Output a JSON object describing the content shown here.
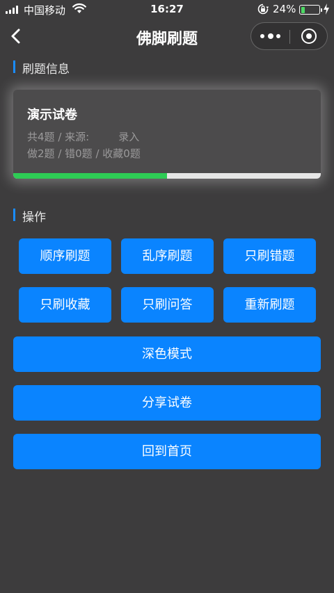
{
  "status_bar": {
    "carrier": "中国移动",
    "time": "16:27",
    "battery_percent": "24%",
    "battery_level": 0.24,
    "icons": [
      "signal-icon",
      "wifi-icon",
      "orientation-lock-icon",
      "battery-icon",
      "charging-bolt-icon"
    ]
  },
  "nav": {
    "title": "佛脚刷题",
    "back_icon": "chevron-left-icon",
    "more_icon": "more-dots-icon",
    "close_icon": "target-circle-icon"
  },
  "info_section": {
    "header": "刷题信息",
    "card": {
      "title": "演示试卷",
      "line1_total": "共4题",
      "line1_sep": " / ",
      "line1_source_label": "来源:",
      "line1_source_value": "录入",
      "line2_done": "做2题",
      "line2_sep1": " / ",
      "line2_wrong": "错0题",
      "line2_sep2": " / ",
      "line2_fav": "收藏0题",
      "progress": 0.5
    }
  },
  "actions_section": {
    "header": "操作",
    "buttons_row1": [
      "顺序刷题",
      "乱序刷题",
      "只刷错题"
    ],
    "buttons_row2": [
      "只刷收藏",
      "只刷问答",
      "重新刷题"
    ],
    "wide_buttons": [
      "深色模式",
      "分享试卷",
      "回到首页"
    ]
  },
  "colors": {
    "background": "#3d3c3d",
    "accent": "#0a84ff",
    "progress": "#2ecc55",
    "card": "#4c4b4c"
  }
}
